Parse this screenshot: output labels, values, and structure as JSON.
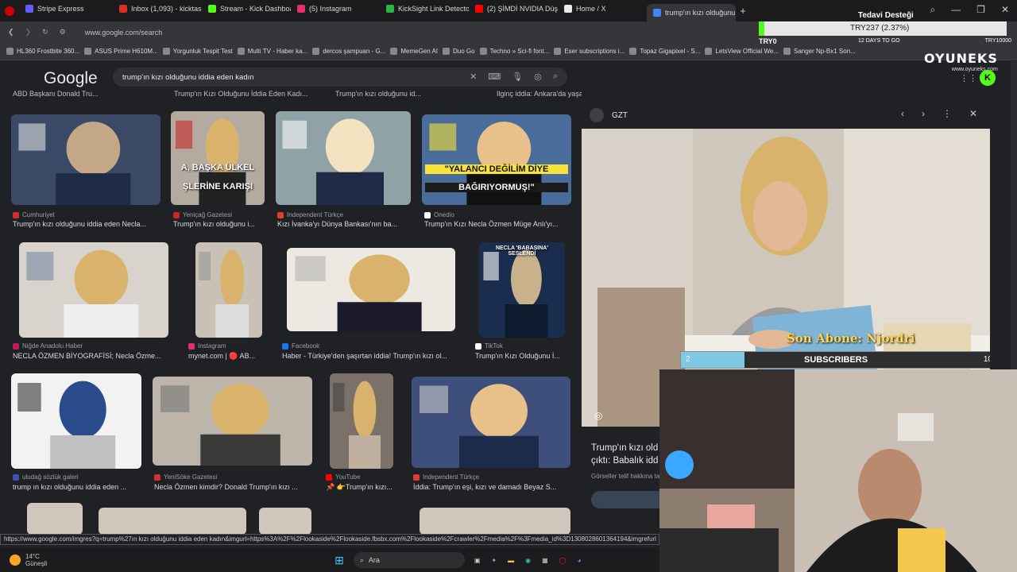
{
  "tabs": [
    {
      "label": "Stripe Express",
      "color": "#635bff"
    },
    {
      "label": "Inbox (1,093) - kicktaskin",
      "color": "#d93025"
    },
    {
      "label": "Stream - Kick Dashboard",
      "color": "#53fc18"
    },
    {
      "label": "(5) Instagram",
      "color": "#e1306c"
    },
    {
      "label": "KickSight Link Detector",
      "color": "#2db34a"
    },
    {
      "label": "(2) ŞİMDİ NVIDIA Düşüns",
      "color": "#ff0000"
    },
    {
      "label": "Home / X",
      "color": "#e7e9ea"
    },
    {
      "label": "trump'ın kızı olduğunu id",
      "color": "#4285f4"
    }
  ],
  "address": {
    "url": "www.google.com/search"
  },
  "bookmarks": [
    "HL360 Frostbite 360...",
    "ASUS Prime H610M...",
    "Yorgunluk Tespit Test",
    "Multi TV - Haber ka...",
    "dercos şampuan - G...",
    "MemeGen AI",
    "Duo Go",
    "Techno » Sci-fi font...",
    "Eser subscriptions i...",
    "Topaz Gigapixel - S...",
    "LetsView Official We...",
    "Sanger Np-Bx1 Son..."
  ],
  "search": {
    "logo": "Google",
    "query": "trump'ın kızı olduğunu iddia eden kadın"
  },
  "top_captions": [
    "ABD Başkanı Donald Tru...",
    "Trump'ın Kızı Olduğunu İddia Eden Kadı...",
    "Trump'ın kızı olduğunu id...",
    "Ilginç iddia: Ankara'da yaşayan kadın, babasının ..."
  ],
  "results": [
    {
      "source": "Cumhuriyet",
      "caption": "Trump'ın kızı olduğunu iddia eden Necla...",
      "color": "#d32f2f"
    },
    {
      "source": "Yeniçağ Gazetesi",
      "caption": "Trump'ın kızı olduğunu i...",
      "color": "#c62828",
      "overlay_a": "A, BAŞKA ÜLKEL",
      "overlay_b": "ŞLERİNE KARIŞI"
    },
    {
      "source": "Independent Türkçe",
      "caption": "Kızı İvanka'yı Dünya Bankası'nın ba...",
      "color": "#e53935"
    },
    {
      "source": "Onedio",
      "caption": "Trump'ın Kızı Necla Özmen Müge Anlı'yı...",
      "color": "#ffffff",
      "overlay_a": "\"YALANCI DEĞİLİM DİYE",
      "overlay_b": "BAĞIRIYORMUŞ!\""
    },
    {
      "source": "Niğde Anadolu Haber",
      "caption": "NECLA ÖZMEN BİYOGRAFİSİ; Necla Özme...",
      "color": "#c2185b"
    },
    {
      "source": "Instagram",
      "caption": "mynet.com | 🔴 AB...",
      "color": "#e1306c"
    },
    {
      "source": "Facebook",
      "caption": "Haber - Türkiye'den şaşırtan iddia! Trump'ın kızı ol...",
      "color": "#1877f2"
    },
    {
      "source": "TikTok",
      "caption": "Trump'ın Kızı Olduğunu İ...",
      "color": "#ffffff",
      "overlay_a": "NECLA 'BABASINA' SESLENDİ"
    },
    {
      "source": "uludağ sözlük galeri",
      "caption": "trump ın kızı olduğunu iddia eden ...",
      "color": "#3f51b5"
    },
    {
      "source": "YeniSöke Gazetesi",
      "caption": "Necla Özmen kimdir? Donald Trump'ın kızı ...",
      "color": "#d32f2f"
    },
    {
      "source": "YouTube",
      "caption": "📌 👉Trump'ın kızı...",
      "color": "#ff0000"
    },
    {
      "source": "Independent Türkçe",
      "caption": "İddia: Trump'ın eşi, kızı ve damadı Beyaz S...",
      "color": "#e53935"
    }
  ],
  "status_url": "https://www.google.com/imgres?q=trump%27ın kızı olduğunu iddia eden kadın&imgurl=https%3A%2F%2Flookaside%2Flookaside.fbsbx.com%2Flookaside%2Fcrawler%2Fmedia%2F%3Fmedia_id%3D1308028601364194&imgrefurl",
  "panel": {
    "source": "GZT",
    "title_a": "Trump'ın kızı old",
    "title_b": "çıktı: Babalık idd",
    "notice": "Görseller telif hakkına ta"
  },
  "overlay": {
    "goal_title": "Tedavi Desteği",
    "goal_amount": "TRY237 (2.37%)",
    "goal_min": "TRY0",
    "goal_days": "12 DAYS TO GO",
    "goal_max": "TRY10000",
    "brand": "OYUNEKS",
    "brand_url": "www.oyuneks.com",
    "last_sub": "Son Abone: Njordri",
    "sub_current": "2",
    "sub_label": "SUBSCRIBERS",
    "sub_goal": "10",
    "sub_progress": 0.2
  },
  "taskbar": {
    "temp": "14°C",
    "weather": "Güneşli",
    "search": "Ara"
  }
}
